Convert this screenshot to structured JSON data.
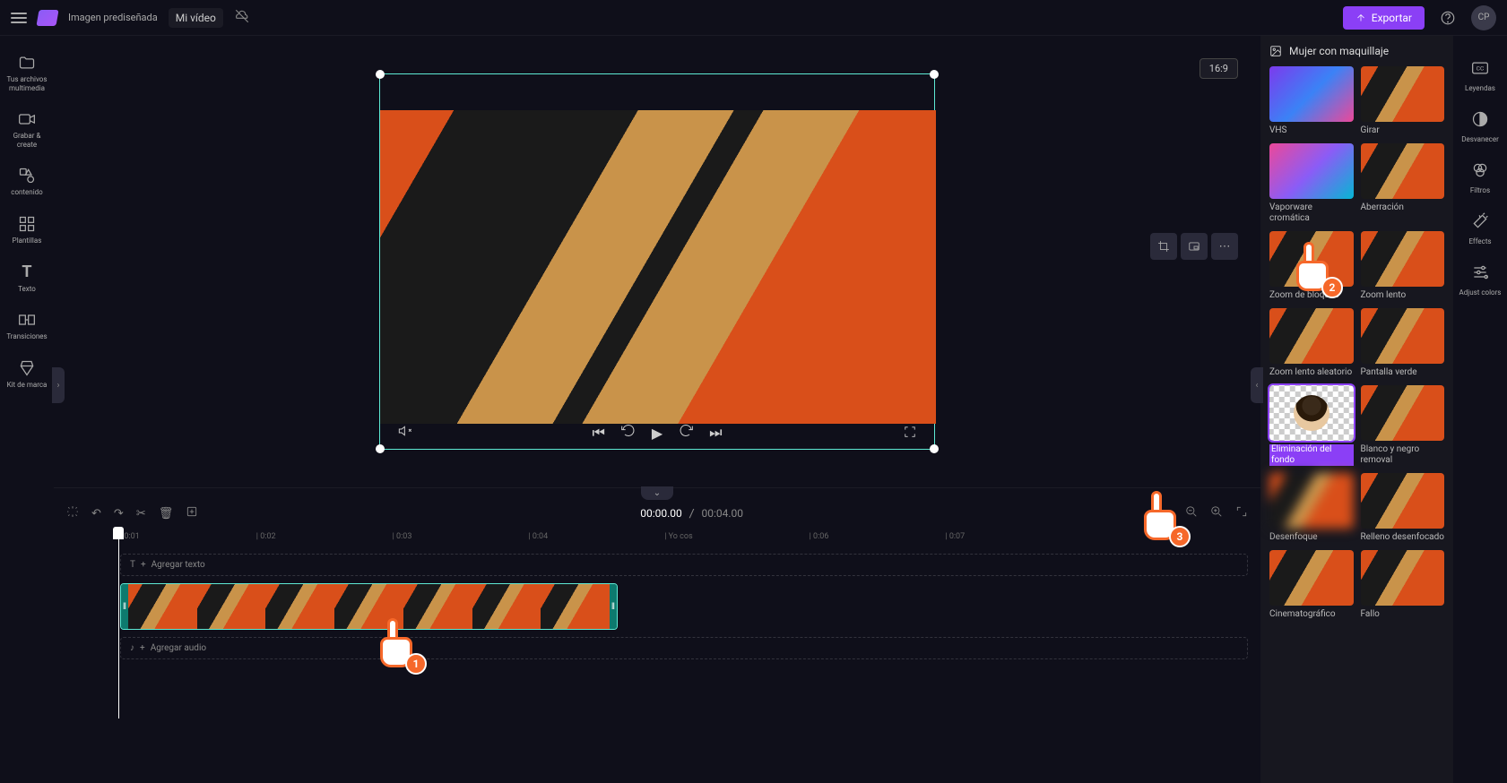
{
  "top": {
    "imagePreset": "Imagen prediseñada",
    "projectName": "Mi vídeo",
    "export": "Exportar",
    "userInitials": "CP"
  },
  "leftRail": [
    {
      "icon": "folder",
      "label": "Tus archivos multimedia"
    },
    {
      "icon": "camera",
      "label": "Grabar &amp; create"
    },
    {
      "icon": "shapes",
      "label": "contenido"
    },
    {
      "icon": "grid",
      "label": "Plantillas"
    },
    {
      "icon": "text",
      "label": "Texto"
    },
    {
      "icon": "transitions",
      "label": "Transiciones"
    },
    {
      "icon": "kit",
      "label": "Kit de marca"
    }
  ],
  "preview": {
    "aspect": "16:9"
  },
  "timeline": {
    "current": "00:00.00",
    "total": "00:04.00",
    "marks": [
      "0:01",
      "0:02",
      "0:03",
      "0:04",
      "Yo cos",
      "0:06",
      "0:07"
    ],
    "addText": "Agregar texto",
    "addAudio": "Agregar audio"
  },
  "rightPanel": {
    "title": "Mujer con maquillaje",
    "effects": [
      {
        "label": "VHS",
        "cls": "vhs"
      },
      {
        "label": "Girar"
      },
      {
        "label": "Vaporware cromática",
        "cls": "vapor"
      },
      {
        "label": "Aberración"
      },
      {
        "label": "Zoom de bloqueo"
      },
      {
        "label": "Zoom lento"
      },
      {
        "label": "Zoom lento aleatorio"
      },
      {
        "label": "Pantalla verde"
      },
      {
        "label": "Eliminación del fondo",
        "cls": "checker",
        "selected": true,
        "hl": true
      },
      {
        "label": "Blanco y negro removal"
      },
      {
        "label": "Desenfoque",
        "cls": "blur"
      },
      {
        "label": "Relleno desenfocado"
      },
      {
        "label": "Cinematográfico"
      },
      {
        "label": "Fallo"
      }
    ]
  },
  "farRail": [
    {
      "icon": "cc",
      "label": "Leyendas"
    },
    {
      "icon": "fade",
      "label": "Desvanecer"
    },
    {
      "icon": "filters",
      "label": "Filtros"
    },
    {
      "icon": "wand",
      "label": "Effects"
    },
    {
      "icon": "adjust",
      "label": "Adjust colors"
    }
  ],
  "pointers": {
    "p1": "1",
    "p2": "2",
    "p3": "3"
  }
}
